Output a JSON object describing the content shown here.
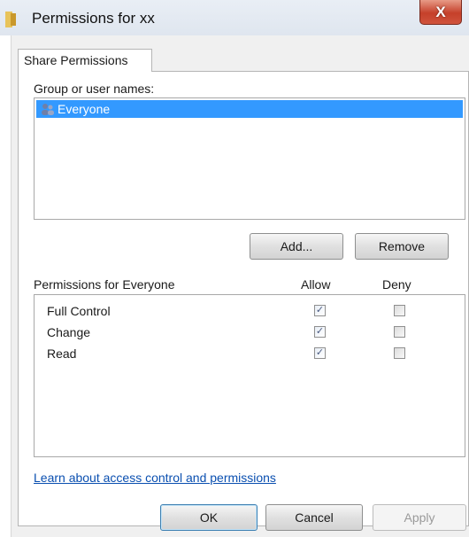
{
  "window": {
    "title": "Permissions for xx",
    "close_label": "X"
  },
  "tabs": [
    {
      "label": "Share Permissions"
    }
  ],
  "users": {
    "header": "Group or user names:",
    "items": [
      {
        "label": "Everyone",
        "selected": true
      }
    ],
    "add_label": "Add...",
    "remove_label": "Remove"
  },
  "permissions": {
    "header": "Permissions for Everyone",
    "allow_label": "Allow",
    "deny_label": "Deny",
    "rows": [
      {
        "name": "Full Control",
        "allow": true,
        "deny": false
      },
      {
        "name": "Change",
        "allow": true,
        "deny": false
      },
      {
        "name": "Read",
        "allow": true,
        "deny": false
      }
    ]
  },
  "help_link": "Learn about access control and permissions",
  "footer": {
    "ok_label": "OK",
    "cancel_label": "Cancel",
    "apply_label": "Apply"
  },
  "colors": {
    "selection": "#3399ff",
    "link": "#0a4fb0",
    "close": "#c5402a"
  },
  "icons": {
    "folder": "folder-icon",
    "users": "users-icon",
    "check": "✓"
  }
}
